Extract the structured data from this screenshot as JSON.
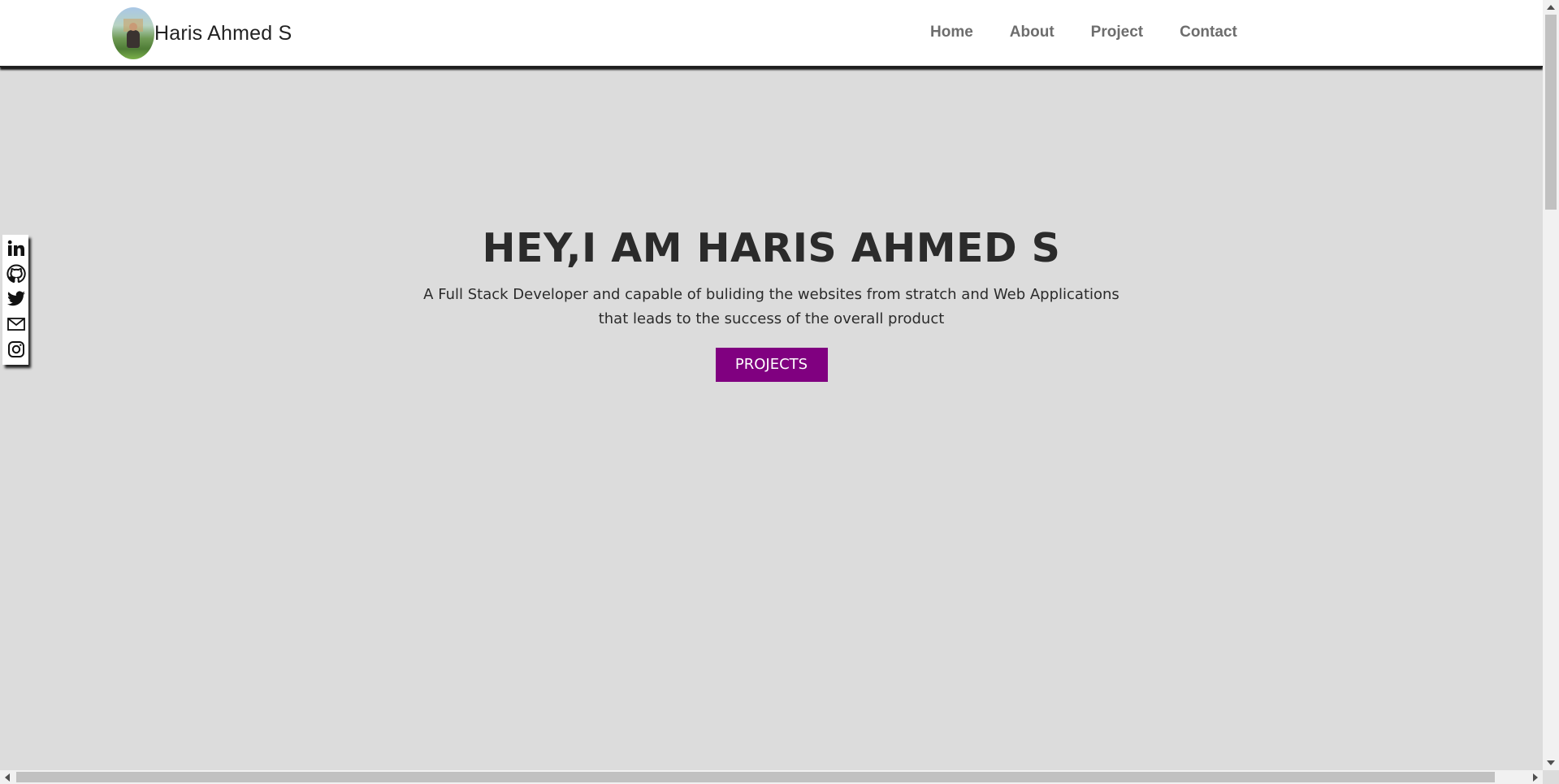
{
  "brand": {
    "name": "Haris Ahmed S"
  },
  "nav": {
    "items": [
      "Home",
      "About",
      "Project",
      "Contact"
    ]
  },
  "social": {
    "icons": [
      "linkedin-icon",
      "github-icon",
      "twitter-icon",
      "mail-icon",
      "instagram-icon"
    ]
  },
  "hero": {
    "title": "HEY,I AM HARIS AHMED S",
    "subtitle_line1": "A Full Stack Developer and capable of buliding the websites from stratch and Web Applications",
    "subtitle_line2": "that leads to the success of the overall product",
    "button": "PROJECTS"
  },
  "colors": {
    "accent": "#800080",
    "background": "#dcdcdc",
    "nav_text": "#6d6d6d"
  }
}
